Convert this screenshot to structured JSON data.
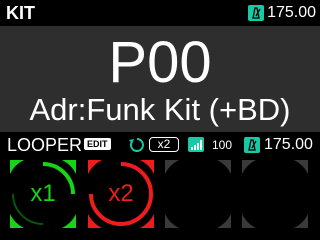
{
  "header": {
    "mode_title": "KIT",
    "tempo": "175.00"
  },
  "preset": {
    "number": "P00",
    "name": "Adr:Funk Kit (+BD)"
  },
  "looper": {
    "label": "LOOPER",
    "edit_label": "EDIT",
    "speed": "x2",
    "level": "100",
    "tempo": "175.00"
  },
  "pads": [
    {
      "label": "x1",
      "color": "#17d417",
      "state": "play"
    },
    {
      "label": "x2",
      "color": "#ee1c1c",
      "state": "record"
    },
    {
      "label": "",
      "color": "#2a2a2a",
      "state": "empty"
    },
    {
      "label": "",
      "color": "#2a2a2a",
      "state": "empty"
    }
  ],
  "colors": {
    "accent": "#17c9a4",
    "panel": "#2e2e2e",
    "play": "#17d417",
    "record": "#ee1c1c"
  },
  "icons": [
    "metronome-icon",
    "loop-speed-icon",
    "level-bars-icon"
  ]
}
